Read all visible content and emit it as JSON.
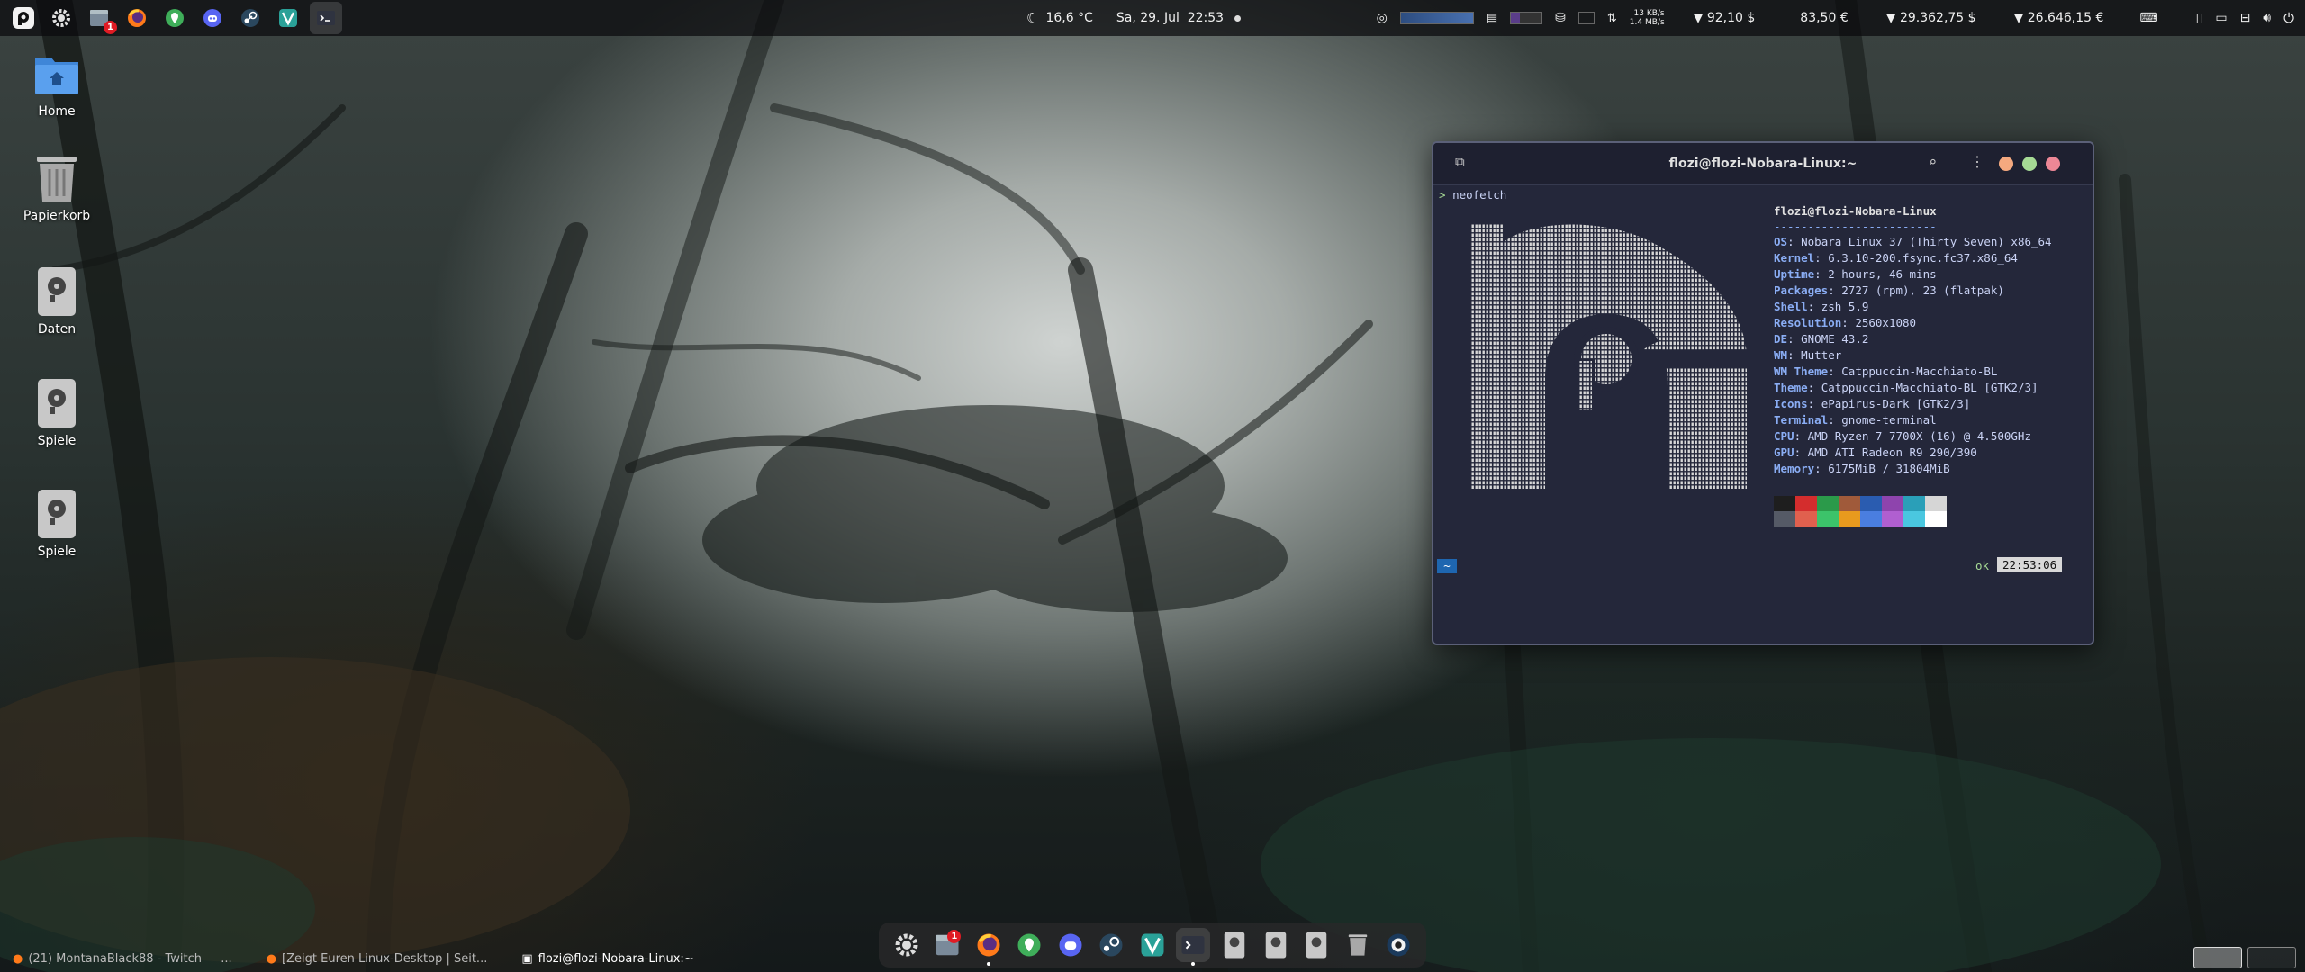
{
  "topbar": {
    "notifications_badge": "1",
    "weather": "16,6 °C",
    "clock": "Sa, 29. Jul  22:53",
    "net_up": "13 KB/s",
    "net_down": "1.4 MB/s",
    "prices": [
      "▼ 92,10 $",
      "83,50 €",
      "▼ 29.362,75 $",
      "▼ 26.646,15 €"
    ]
  },
  "desktop_icons": [
    {
      "label": "Home"
    },
    {
      "label": "Papierkorb"
    },
    {
      "label": "Daten"
    },
    {
      "label": "Spiele"
    },
    {
      "label": "Spiele"
    }
  ],
  "terminal": {
    "title": "flozi@flozi-Nobara-Linux:~",
    "prompt_symbol": ">",
    "command": "neofetch",
    "header": "flozi@flozi-Nobara-Linux",
    "separator": "------------------------",
    "info": [
      {
        "key": "OS",
        "value": "Nobara Linux 37 (Thirty Seven) x86_64"
      },
      {
        "key": "Kernel",
        "value": "6.3.10-200.fsync.fc37.x86_64"
      },
      {
        "key": "Uptime",
        "value": "2 hours, 46 mins"
      },
      {
        "key": "Packages",
        "value": "2727 (rpm), 23 (flatpak)"
      },
      {
        "key": "Shell",
        "value": "zsh 5.9"
      },
      {
        "key": "Resolution",
        "value": "2560x1080"
      },
      {
        "key": "DE",
        "value": "GNOME 43.2"
      },
      {
        "key": "WM",
        "value": "Mutter"
      },
      {
        "key": "WM Theme",
        "value": "Catppuccin-Macchiato-BL"
      },
      {
        "key": "Theme",
        "value": "Catppuccin-Macchiato-BL [GTK2/3]"
      },
      {
        "key": "Icons",
        "value": "ePapirus-Dark [GTK2/3]"
      },
      {
        "key": "Terminal",
        "value": "gnome-terminal"
      },
      {
        "key": "CPU",
        "value": "AMD Ryzen 7 7700X (16) @ 4.500GHz"
      },
      {
        "key": "GPU",
        "value": "AMD ATI Radeon R9 290/390"
      },
      {
        "key": "Memory",
        "value": "6175MiB / 31804MiB"
      }
    ],
    "palette_top": [
      "#1e1e1e",
      "#d42d2d",
      "#2b9a4a",
      "#a05a3a",
      "#2a5cb0",
      "#8e44ad",
      "#2a9fb8",
      "#d6d6d6"
    ],
    "palette_bottom": [
      "#555a66",
      "#e0604e",
      "#3cc36a",
      "#e89a1e",
      "#4a7ee0",
      "#b05fd0",
      "#4ac7e0",
      "#ffffff"
    ],
    "status_left": "~",
    "status_ok": "ok",
    "status_time": "22:53:06"
  },
  "taskbar": {
    "tasks": [
      {
        "label": "(21) MontanaBlack88 - Twitch — ..."
      },
      {
        "label": "[Zeigt Euren Linux-Desktop | Seit..."
      },
      {
        "label": "flozi@flozi-Nobara-Linux:~"
      }
    ]
  },
  "dock": {
    "badge": "1"
  },
  "colors": {
    "terminal_bg": "#24273a",
    "accent": "#8aadf4",
    "close": "#ed8796",
    "maximize": "#a6da95",
    "minimize": "#f5a97f"
  }
}
